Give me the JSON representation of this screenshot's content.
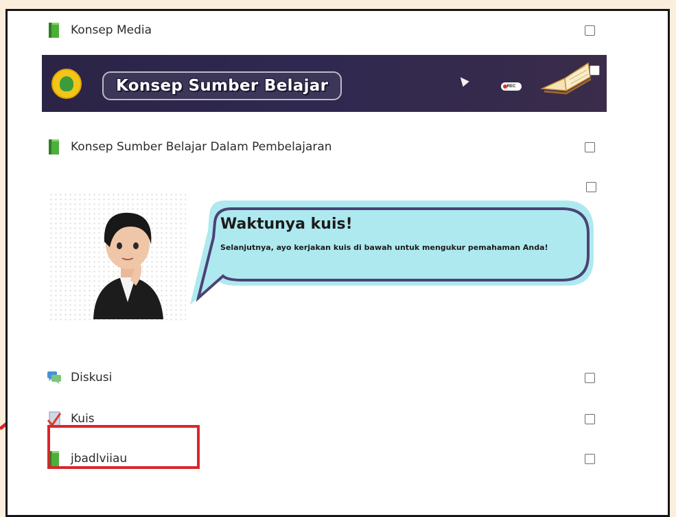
{
  "items": [
    {
      "label": "Konsep Media",
      "icon": "book-icon"
    },
    {
      "label": "Konsep Sumber Belajar Dalam Pembelajaran",
      "icon": "book-icon"
    },
    {
      "label": "Diskusi",
      "icon": "forum-icon"
    },
    {
      "label": "Kuis",
      "icon": "quiz-icon"
    },
    {
      "label": "jbadlviiau",
      "icon": "book-icon"
    }
  ],
  "banner": {
    "title": "Konsep Sumber Belajar",
    "rec_label": "REC"
  },
  "quiz_card": {
    "title": "Waktunya kuis!",
    "text": "Selanjutnya, ayo kerjakan kuis di bawah untuk mengukur pemahaman Anda!"
  },
  "colors": {
    "background": "#fbeedd",
    "highlight": "#d9262b",
    "banner": "#2c2446",
    "bubble": "#aee9ef",
    "bubble_border": "#4b4375"
  }
}
